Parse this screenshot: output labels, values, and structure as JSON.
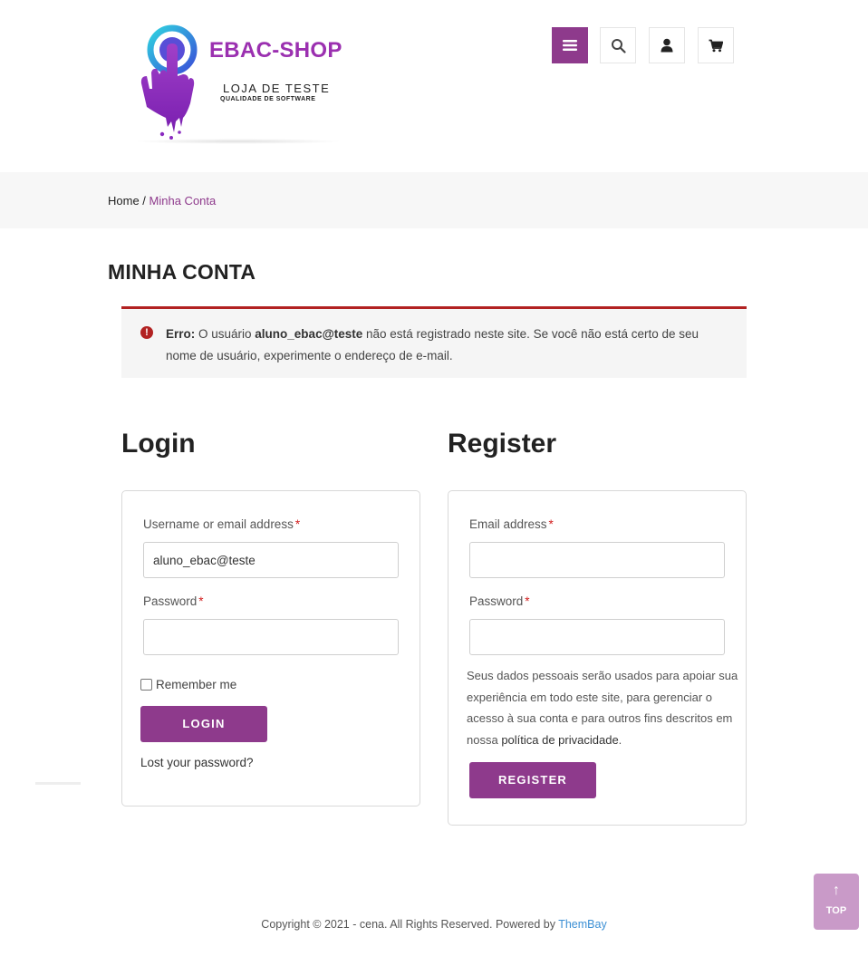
{
  "header": {
    "logo_title": "EBAC-SHOP",
    "logo_subtitle": "LOJA DE TESTE",
    "logo_tagline": "QUALIDADE DE SOFTWARE",
    "icons": [
      "menu-icon",
      "search-icon",
      "user-icon",
      "cart-icon"
    ],
    "menu_color": "#8e3a8c"
  },
  "breadcrumb": {
    "home": "Home",
    "separator": " / ",
    "current": "Minha Conta"
  },
  "page": {
    "title": "MINHA CONTA"
  },
  "notice": {
    "label": "Erro:",
    "text_before": " O usuário ",
    "username": "aluno_ebac@teste",
    "text_after": " não está registrado neste site. Se você não está certo de seu nome de usuário, experimente o endereço de e-mail.",
    "color": "#b22222"
  },
  "login": {
    "heading": "Login",
    "username_label": "Username or email address",
    "username_value": "aluno_ebac@teste",
    "password_label": "Password",
    "password_value": "",
    "required_mark": "*",
    "remember_label": "Remember me",
    "remember_checked": false,
    "button": "LOGIN",
    "lost_password": "Lost your password?"
  },
  "register": {
    "heading": "Register",
    "email_label": "Email address",
    "email_value": "",
    "password_label": "Password",
    "password_value": "",
    "required_mark": "*",
    "privacy_text": "Seus dados pessoais serão usados para apoiar sua experiência em todo este site, para gerenciar o acesso à sua conta e para outros fins descritos em nossa ",
    "privacy_link": "política de privacidade",
    "privacy_end": ".",
    "button": "REGISTER"
  },
  "footer": {
    "text": "Copyright © 2021 - cena. All Rights Reserved. Powered by ",
    "brand": "ThemBay"
  },
  "top_button": {
    "arrow": "↑",
    "label": "TOP"
  },
  "colors": {
    "accent": "#8e3a8c",
    "error": "#b22222",
    "link": "#3b8fd4"
  }
}
